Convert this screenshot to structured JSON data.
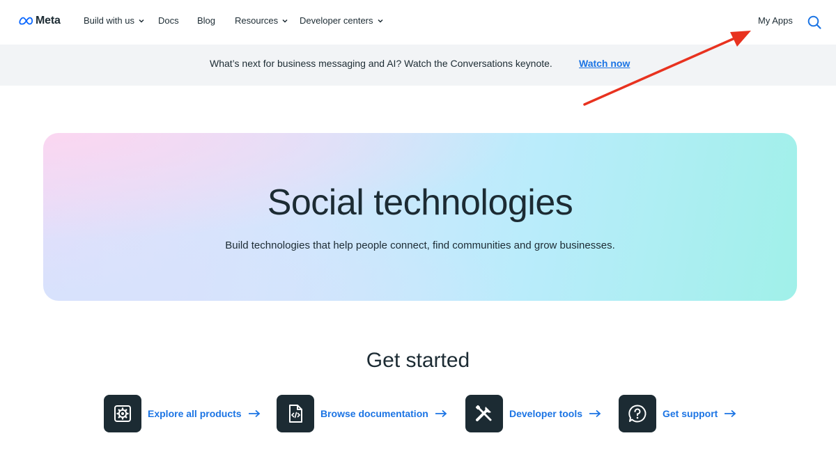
{
  "nav": {
    "logo_text": "Meta",
    "items": [
      {
        "label": "Build with us"
      },
      {
        "label": "Docs"
      },
      {
        "label": "Blog"
      },
      {
        "label": "Resources"
      },
      {
        "label": "Developer centers"
      }
    ],
    "my_apps": "My Apps"
  },
  "banner": {
    "text": "What’s next for business messaging and AI? Watch the Conversations keynote.",
    "link": "Watch now"
  },
  "hero": {
    "title": "Social technologies",
    "subtitle": "Build technologies that help people connect, find communities and grow businesses."
  },
  "get_started": {
    "title": "Get started",
    "cards": [
      {
        "label": "Explore all products",
        "icon": "gear-icon"
      },
      {
        "label": "Browse documentation",
        "icon": "code-document-icon"
      },
      {
        "label": "Developer tools",
        "icon": "tools-icon"
      },
      {
        "label": "Get support",
        "icon": "help-bubble-icon"
      }
    ]
  },
  "colors": {
    "text": "#1c2b33",
    "link": "#1b74e4",
    "banner_bg": "#f2f4f6",
    "annotation_arrow": "#e8321f"
  }
}
